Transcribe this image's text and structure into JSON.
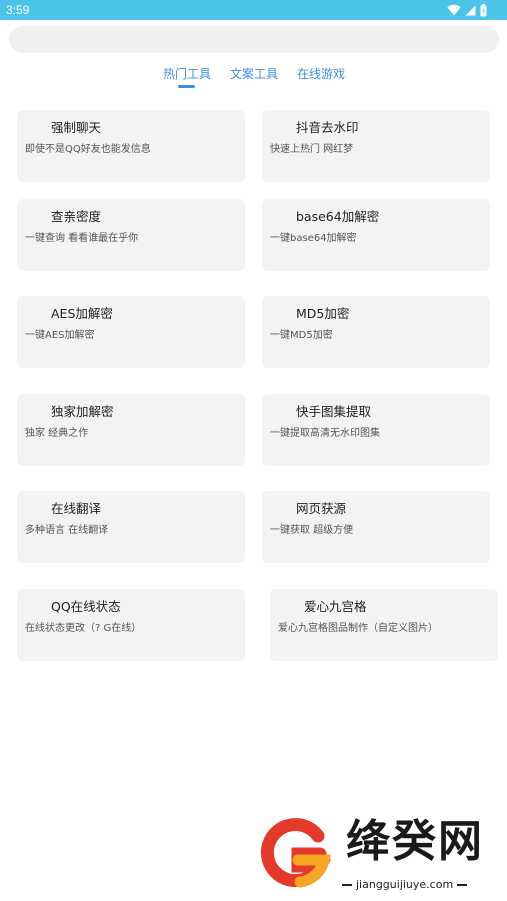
{
  "status_bar": {
    "time": "3:59"
  },
  "search": {
    "value": "",
    "placeholder": ""
  },
  "tabs": [
    {
      "label": "热门工具",
      "active": true
    },
    {
      "label": "文案工具",
      "active": false
    },
    {
      "label": "在线游戏",
      "active": false
    }
  ],
  "tools": [
    {
      "title": "强制聊天",
      "desc": "即使不是QQ好友也能发信息"
    },
    {
      "title": "抖音去水印",
      "desc": "快速上热门 网红梦"
    },
    {
      "title": "查亲密度",
      "desc": "一键查询 看看谁最在乎你"
    },
    {
      "title": "base64加解密",
      "desc": "一键base64加解密"
    },
    {
      "title": "AES加解密",
      "desc": "一键AES加解密"
    },
    {
      "title": "MD5加密",
      "desc": "一键MD5加密"
    },
    {
      "title": "独家加解密",
      "desc": "独家 经典之作"
    },
    {
      "title": "快手图集提取",
      "desc": "一键提取高清无水印图集"
    },
    {
      "title": "在线翻译",
      "desc": "多种语言 在线翻译"
    },
    {
      "title": "网页获源",
      "desc": "一键获取 超级方便"
    },
    {
      "title": "QQ在线状态",
      "desc": "在线状态更改（? G在线）"
    },
    {
      "title": "爱心九宫格",
      "desc": "爱心九宫格图品制作（自定义图片）"
    }
  ],
  "watermark": {
    "name": "绛癸网",
    "url": "jiangguijiuye.com"
  },
  "colors": {
    "status_bar": "#4cc3e8",
    "accent": "#3d8ee0",
    "card_bg": "#f3f3f3",
    "logo_red": "#e53a2b",
    "logo_orange": "#f5a623"
  }
}
